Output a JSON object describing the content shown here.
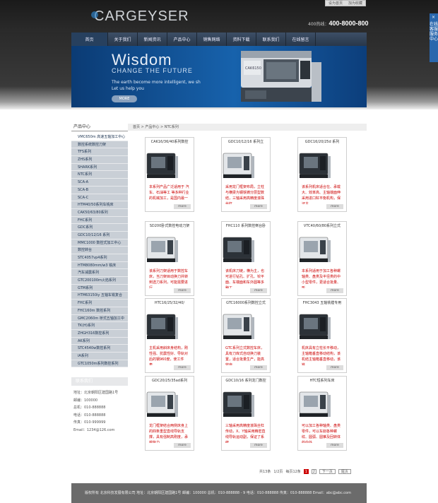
{
  "header": {
    "logo": "CARGEYSER",
    "top_links": [
      "设为首页",
      "加为收藏"
    ],
    "hotline_label": "400热线：",
    "hotline_number": "400-8000-800"
  },
  "nav": [
    "首页",
    "关于我们",
    "新闻资讯",
    "产品中心",
    "销售网络",
    "资料下载",
    "联系我们",
    "在线留言"
  ],
  "banner": {
    "title": "Wisdom",
    "subtitle": "CHANGE THE FUTURE",
    "line1": "The earth become more intelligent, we sh",
    "line2": "Let us help you",
    "button": "MORE"
  },
  "sidebar": {
    "title": "产品中心",
    "items": [
      "VMC650m 高速五轴加工中心",
      "数控系统数控刀架",
      "TFS系列",
      "ZHS系列",
      "SHARK系列",
      "NTC系列",
      "SCA-A",
      "SCA-B",
      "SCA-C",
      "HTM40/50系列车铣床",
      "CAK50/63/80系列",
      "FHC系列",
      "GDC系列",
      "GDC10/12/16 系列",
      "MMC1000 数控式加工中心",
      "数控转台",
      "STC4057vp4系列",
      "HTM8080mm/w3 铣床",
      "汽车减震系列",
      "GTC200100m火焰系列",
      "GTM系列",
      "HTM63150iy 五轴车铣复合",
      "FHC系列",
      "FHC160m 数控系列",
      "GMC2060m 桥式五轴加工中",
      "TK(H)系列",
      "ZHGH316数控系列",
      "AK系列",
      "STC4540w数控系列",
      "iA系列",
      "GTC1050m系列数控系列"
    ]
  },
  "contact": {
    "title": "联系我们",
    "lines": [
      "地址：北京朝阳区建国路1号",
      "邮编：100000",
      "总机：010-888888",
      "电话：010-888888",
      "传真：010-999999",
      "Email：1234@126.com"
    ]
  },
  "breadcrumb": "首页 > 产品中心 > NTC系列",
  "products": [
    {
      "title": "CAK16/36/40系列数控",
      "desc": "本系列产品广泛适用于 汽车、石油等工 等多种行业的机械加工，是国内最一",
      "more": "more"
    },
    {
      "title": "GDC10/12/16 系列立",
      "desc": "采用龙门框架布局，立柱与横梁为钢铁铸分层型数结，三轴采用高精度滚珠丝杠 ...",
      "more": "more"
    },
    {
      "title": "GDC16/20/25d 系列",
      "desc": "该系列机床适合在、承载大、效率高、主轴端面伸采用进口缸平衡机构，保证主...",
      "more": "more"
    },
    {
      "title": "SD200卧式数控电动刀架",
      "desc": "该系列刀架适用于数控车床，当刀架目动换刀并转到选刀系列，可能需要进行",
      "more": "more"
    },
    {
      "title": "FHC110 系列数控倒台卧",
      "desc": "该机床刀链，横为主，也可进行钻孔、扩孔、铰平面、车端面和车外圆等多种工",
      "more": "more"
    },
    {
      "title": "VTC40/60/80系列立式",
      "desc": "本系列适用于加工各种螺轴类、盘类及半径类的中小型零件，更适合批量、形",
      "more": "more"
    },
    {
      "title": "HTC16/25/32/40/",
      "desc": "主机采用斜床身结构，刚性强、抗震性好、导轨对后的钢960度，使工件表...",
      "more": "more"
    },
    {
      "title": "GTC16000系列数控立式",
      "desc": "GTC系列立式数控车床，具有刀库式自动换刀装置，适合批量生产，能高效自",
      "more": "more"
    },
    {
      "title": "FHC3043 五轴铣镗专用",
      "desc": "机床具有立柱长平移动，主轴箱垂直移动结构，该机结主轴箱垂直移动，该铣",
      "more": "more"
    },
    {
      "title": "GDC20/25/35ad系列",
      "desc": "龙门框架结合两侧床身上的四条重型直线导轨支撑，具有强制高刚度，承载能力",
      "more": "more"
    },
    {
      "title": "GDC10/16 系列龙门数控",
      "desc": "三轴采用高精度滚珠丝杠传动，X、Y轴采用精密直线导轨运动副，保证了系统",
      "more": "more"
    },
    {
      "title": "HTC短系列车床",
      "desc": "可以加工各种轴类、盘类零件，可以车削各种螺纹、圆弧、圆锥及回转体的内外",
      "more": "more"
    }
  ],
  "pagination": {
    "summary": "共13条",
    "page_info": "1/2页",
    "per_page": "每页12条",
    "pages": [
      "1",
      "2"
    ],
    "next": "下一页",
    "last": "尾页"
  },
  "footer": "版权所有  北京科技发展有限公司  地址：北京朝阳区建国路1号  邮编：100000    总机：010-888888 - 9  电话：010-888888  传真：010-888888  Email：abc@abc.com",
  "side_tab": {
    "close": "×",
    "text": "在线客服服务中心"
  },
  "colors": {
    "nav_bg": "#2f4058",
    "banner_blue": "#1762ac",
    "sidebar_bg": "#c9cfd6",
    "product_desc": "#cc0000",
    "pager_current": "#cc0000",
    "footer_bg": "#6b6b6b"
  }
}
